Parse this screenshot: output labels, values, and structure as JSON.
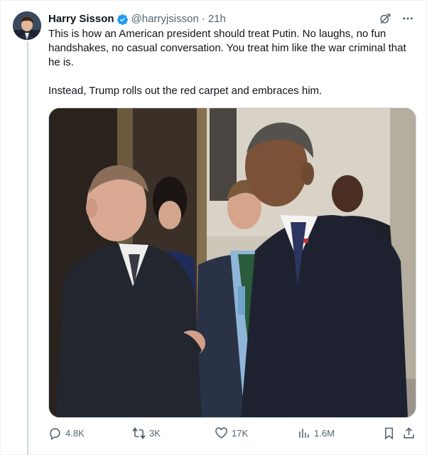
{
  "tweet": {
    "author_name": "Harry Sisson",
    "handle": "@harryjsisson",
    "separator": "·",
    "time": "21h",
    "paragraphs": [
      "This is how an American president should treat Putin. No laughs, no fun handshakes, no casual conversation. You treat him like the war criminal that he is.",
      "Instead, Trump rolls out the red carpet and embraces him."
    ],
    "media_icon": "photo",
    "header_icons": [
      "grok-icon",
      "more-icon"
    ]
  },
  "actions": {
    "replies": "4.8K",
    "reposts": "3K",
    "likes": "17K",
    "views": "1.6M",
    "icons": [
      "reply-icon",
      "repost-icon",
      "like-icon",
      "views-icon",
      "bookmark-icon",
      "share-icon"
    ]
  },
  "colors": {
    "text": "#0f1419",
    "secondary": "#536471",
    "verified": "#1d9bf0",
    "border": "#cfd9de"
  }
}
